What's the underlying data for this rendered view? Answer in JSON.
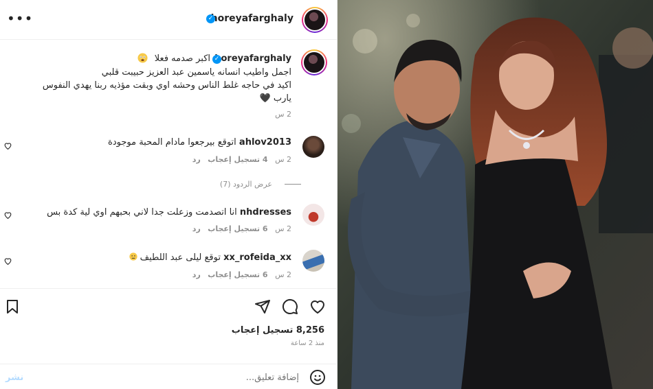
{
  "header": {
    "username": "horeyafarghaly",
    "more_icon": "more-horizontal-icon"
  },
  "caption": {
    "username": "horeyafarghaly",
    "first_line": "اكبر صدمه فعلا",
    "emoji": "emoji-shocked-icon",
    "lines": [
      "اجمل واطيب انسانه ياسمين عبد العزيز حبيبت قلبي",
      "اكيد في حاجه غلط الناس وحشه اوي وبقت مؤذيه ربنا يهدي النفوس",
      "يارب 🖤"
    ],
    "time": "2 س"
  },
  "comments": [
    {
      "username": "ahlov2013",
      "text": "اتوقع بيرجعوا مادام المحبة موجودة",
      "time": "2 س",
      "likes": "4 تسجيل إعجاب",
      "reply": "رد"
    },
    {
      "username": "nhdresses",
      "text": "انا اتصدمت وزعلت جدا لاني بحبهم اوي لية كدة بس",
      "time": "2 س",
      "likes": "6 تسجيل إعجاب",
      "reply": "رد"
    },
    {
      "username": "xx_rofeida_xx",
      "text": "توقع ليلى عبد اللطيف",
      "time": "2 س",
      "likes": "6 تسجيل إعجاب",
      "reply": "رد"
    }
  ],
  "view_replies": "عرض الردود (7)",
  "actions": {
    "like_icon": "heart-icon",
    "comment_icon": "comment-icon",
    "share_icon": "send-icon",
    "save_icon": "bookmark-icon"
  },
  "likes_count": "8,256 تسجيل إعجاب",
  "posted_time": "منذ 2 ساعة",
  "comment_box": {
    "placeholder": "إضافة تعليق...",
    "post_label": "نشر",
    "emoji_icon": "smiley-icon"
  },
  "colors": {
    "verified": "#0095f6",
    "meta_text": "#8e8e8e",
    "post_disabled": "#b3dbff"
  }
}
